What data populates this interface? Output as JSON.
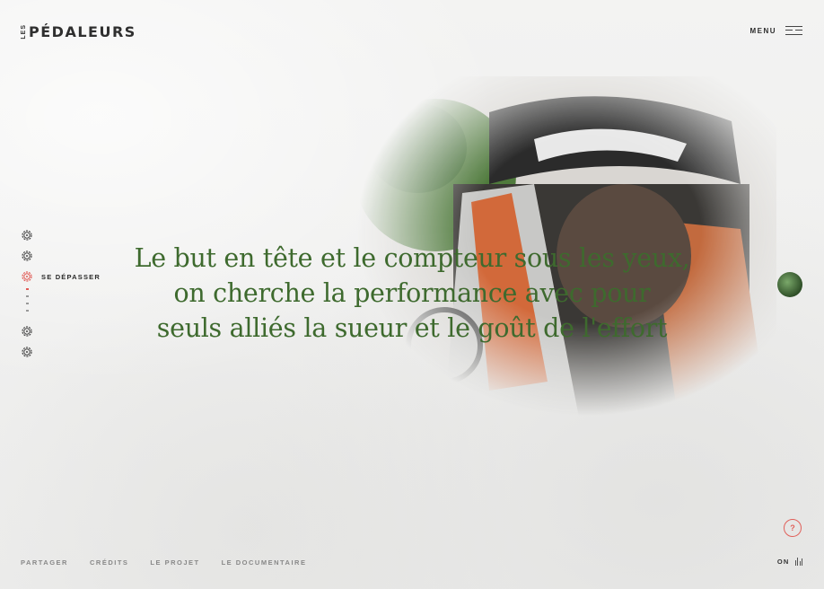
{
  "brand": {
    "prefix": "LES",
    "name": "PÉDALEURS"
  },
  "menu": {
    "label": "MENU",
    "icon": "hamburger-icon"
  },
  "side_nav": {
    "items": [
      {
        "icon": "gear-icon",
        "label": ""
      },
      {
        "icon": "gear-icon",
        "label": ""
      },
      {
        "icon": "gear-icon",
        "label": "SE DÉPASSER",
        "active": true
      },
      {
        "icon": "gear-icon",
        "label": ""
      },
      {
        "icon": "gear-icon",
        "label": ""
      }
    ],
    "active_color": "#e05a55"
  },
  "quote": {
    "lines": [
      "Le but en tête et le compteur sous les yeux,",
      "on cherche la performance avec pour",
      "seuls alliés la sueur et le goût de l'effort"
    ],
    "color": "#3e6a2e"
  },
  "footer": {
    "links": [
      "PARTAGER",
      "CRÉDITS",
      "LE PROJET",
      "LE DOCUMENTAIRE"
    ],
    "sound_label": "ON"
  },
  "help": {
    "label": "?",
    "color": "#e0605a"
  }
}
